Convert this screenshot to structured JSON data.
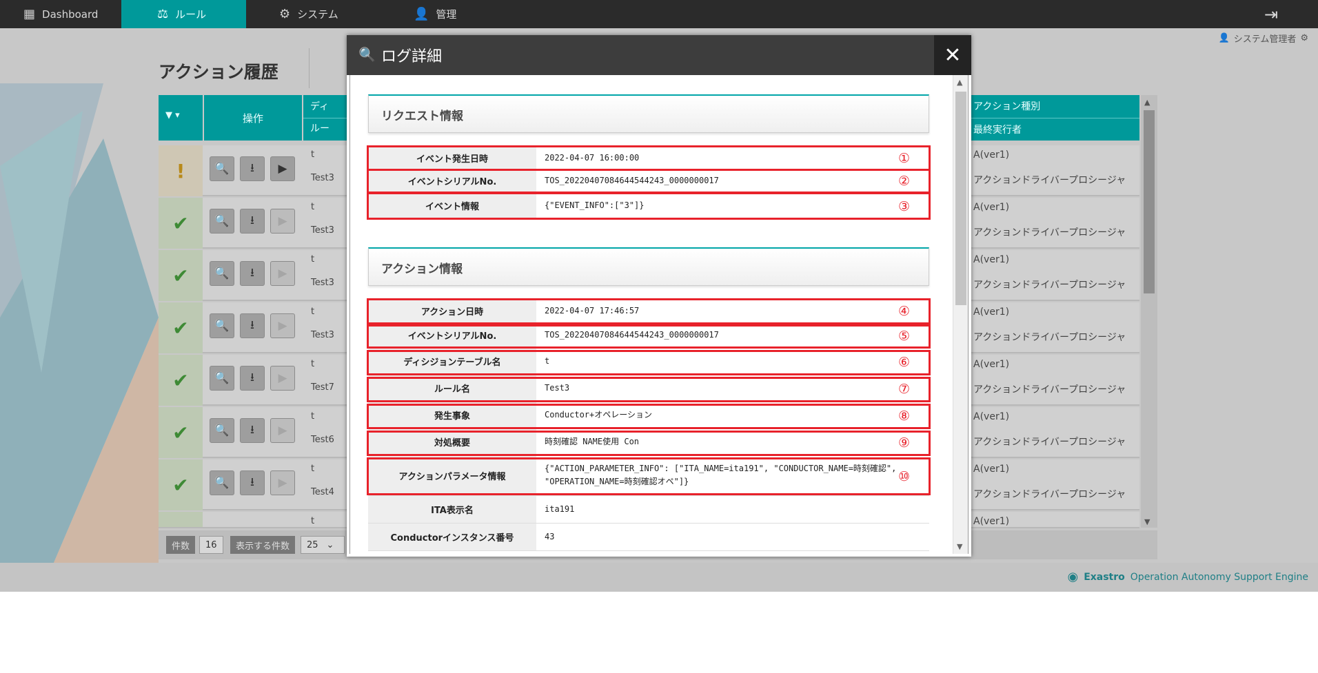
{
  "nav": {
    "items": [
      {
        "label": "Dashboard",
        "icon": "dashboard-icon",
        "glyph": "▦"
      },
      {
        "label": "ルール",
        "icon": "scales-icon",
        "glyph": "⚖"
      },
      {
        "label": "システム",
        "icon": "gears-icon",
        "glyph": "⚙"
      },
      {
        "label": "管理",
        "icon": "user-admin-icon",
        "glyph": "👤"
      }
    ],
    "active_color": "#00999a",
    "logout_glyph": "⇥"
  },
  "user": {
    "name": "システム管理者"
  },
  "page": {
    "title": "アクション履歴",
    "header": {
      "ops": "操作",
      "col_top_left": "ディ",
      "col_bottom_left": "ルー",
      "col_top_right": "アクション種別",
      "col_bottom_right": "最終実行者"
    },
    "rows": [
      {
        "status": "warn",
        "c1": "t",
        "c2": "Test3",
        "run_enabled": true,
        "r1": "A(ver1)",
        "r2": "アクションドライバープロシージャ"
      },
      {
        "status": "ok",
        "c1": "t",
        "c2": "Test3",
        "run_enabled": false,
        "r1": "A(ver1)",
        "r2": "アクションドライバープロシージャ"
      },
      {
        "status": "ok",
        "c1": "t",
        "c2": "Test3",
        "run_enabled": false,
        "r1": "A(ver1)",
        "r2": "アクションドライバープロシージャ"
      },
      {
        "status": "ok",
        "c1": "t",
        "c2": "Test3",
        "run_enabled": false,
        "r1": "A(ver1)",
        "r2": "アクションドライバープロシージャ"
      },
      {
        "status": "ok",
        "c1": "t",
        "c2": "Test7",
        "run_enabled": false,
        "r1": "A(ver1)",
        "r2": "アクションドライバープロシージャ"
      },
      {
        "status": "ok",
        "c1": "t",
        "c2": "Test6",
        "run_enabled": false,
        "r1": "A(ver1)",
        "r2": "アクションドライバープロシージャ"
      },
      {
        "status": "ok",
        "c1": "t",
        "c2": "Test4",
        "run_enabled": false,
        "r1": "A(ver1)",
        "r2": "アクションドライバープロシージャ"
      },
      {
        "status": "ok",
        "c1": "t",
        "c2": "",
        "run_enabled": false,
        "r1": "A(ver1)",
        "r2": ""
      }
    ],
    "footer": {
      "count_label": "件数",
      "count_value": "16",
      "perpage_label": "表示する件数",
      "perpage_value": "25"
    },
    "brand": {
      "bold": "Exastro",
      "rest": "Operation Autonomy Support Engine"
    }
  },
  "modal": {
    "title": "ログ詳細",
    "close_glyph": "✕",
    "request_section": {
      "title": "リクエスト情報",
      "rows": [
        {
          "label": "イベント発生日時",
          "value": "2022-04-07 16:00:00",
          "num": "①"
        },
        {
          "label": "イベントシリアルNo.",
          "value": "TOS_20220407084644544243_0000000017",
          "num": "②"
        },
        {
          "label": "イベント情報",
          "value": "{\"EVENT_INFO\":[\"3\"]}",
          "num": "③"
        }
      ]
    },
    "action_section": {
      "title": "アクション情報",
      "rows": [
        {
          "label": "アクション日時",
          "value": "2022-04-07 17:46:57",
          "num": "④"
        },
        {
          "label": "イベントシリアルNo.",
          "value": "TOS_20220407084644544243_0000000017",
          "num": "⑤"
        },
        {
          "label": "ディシジョンテーブル名",
          "value": "t",
          "num": "⑥"
        },
        {
          "label": "ルール名",
          "value": "Test3",
          "num": "⑦"
        },
        {
          "label": "発生事象",
          "value": "Conductor+オペレーション",
          "num": "⑧"
        },
        {
          "label": "対処概要",
          "value": "時刻確認 NAME使用 Con",
          "num": "⑨"
        },
        {
          "label": "アクションパラメータ情報",
          "value": "{\"ACTION_PARAMETER_INFO\": [\"ITA_NAME=ita191\", \"CONDUCTOR_NAME=時刻確認\",\n\"OPERATION_NAME=時刻確認オペ\"]}",
          "num": "⑩"
        },
        {
          "label": "ITA表示名",
          "value": "ita191",
          "num": ""
        },
        {
          "label": "Conductorインスタンス番号",
          "value": "43",
          "num": ""
        }
      ]
    },
    "highlight_color": "#e8222b"
  }
}
